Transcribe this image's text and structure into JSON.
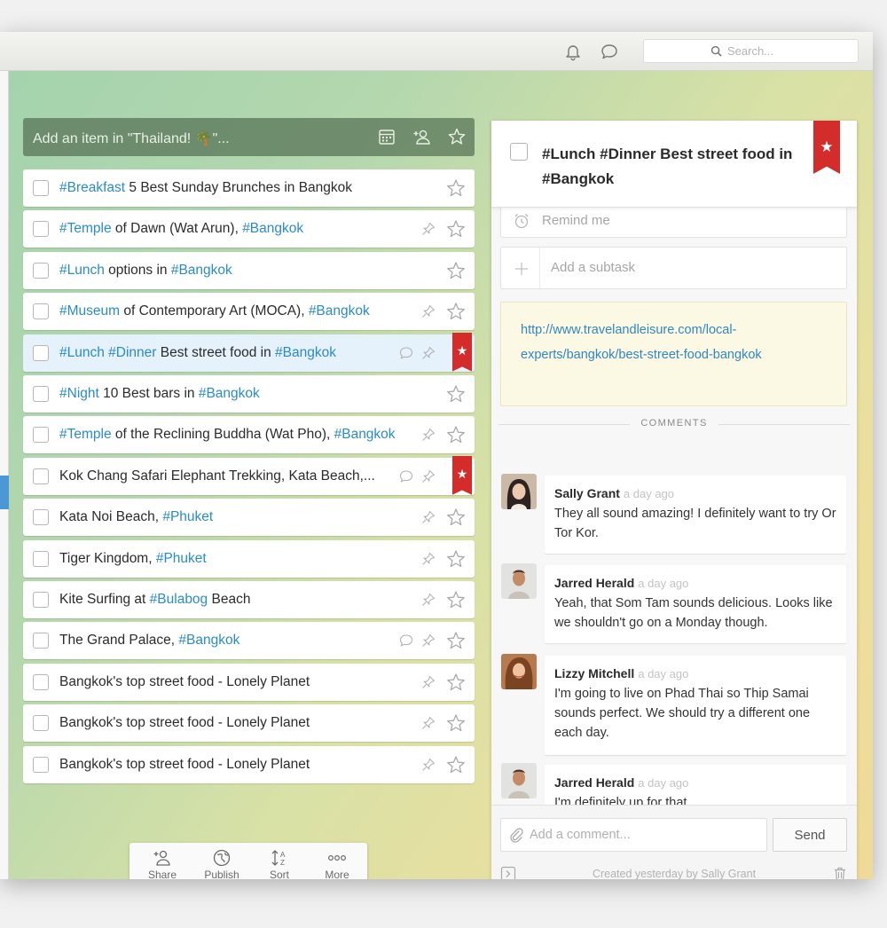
{
  "header": {
    "search_placeholder": "Search..."
  },
  "list": {
    "add_placeholder": "Add an item in \"Thailand! 🌴\"...",
    "tasks": [
      {
        "parts": [
          {
            "t": "#Breakfast",
            "tag": true
          },
          {
            "t": " 5 Best Sunday Brunches in Bangkok"
          }
        ],
        "pin": false,
        "comment": false,
        "starred": false,
        "selected": false
      },
      {
        "parts": [
          {
            "t": "#Temple",
            "tag": true
          },
          {
            "t": " of Dawn (Wat Arun), "
          },
          {
            "t": "#Bangkok",
            "tag": true
          }
        ],
        "pin": true,
        "comment": false,
        "starred": false,
        "selected": false
      },
      {
        "parts": [
          {
            "t": "#Lunch",
            "tag": true
          },
          {
            "t": " options in "
          },
          {
            "t": "#Bangkok",
            "tag": true
          }
        ],
        "pin": false,
        "comment": false,
        "starred": false,
        "selected": false
      },
      {
        "parts": [
          {
            "t": "#Museum",
            "tag": true
          },
          {
            "t": " of Contemporary Art (MOCA), "
          },
          {
            "t": "#Bangkok",
            "tag": true
          }
        ],
        "pin": true,
        "comment": false,
        "starred": false,
        "selected": false
      },
      {
        "parts": [
          {
            "t": "#Lunch",
            "tag": true
          },
          {
            "t": " "
          },
          {
            "t": "#Dinner",
            "tag": true
          },
          {
            "t": " Best street food in "
          },
          {
            "t": "#Bangkok",
            "tag": true
          }
        ],
        "pin": true,
        "comment": true,
        "starred": true,
        "selected": true
      },
      {
        "parts": [
          {
            "t": "#Night",
            "tag": true
          },
          {
            "t": " 10 Best bars in "
          },
          {
            "t": "#Bangkok",
            "tag": true
          }
        ],
        "pin": false,
        "comment": false,
        "starred": false,
        "selected": false
      },
      {
        "parts": [
          {
            "t": "#Temple",
            "tag": true
          },
          {
            "t": " of the Reclining Buddha (Wat Pho), "
          },
          {
            "t": "#Bangkok",
            "tag": true
          }
        ],
        "pin": true,
        "comment": false,
        "starred": false,
        "selected": false
      },
      {
        "parts": [
          {
            "t": "Kok Chang Safari Elephant Trekking, Kata Beach,..."
          }
        ],
        "pin": true,
        "comment": true,
        "starred": true,
        "selected": false
      },
      {
        "parts": [
          {
            "t": "Kata Noi Beach, "
          },
          {
            "t": "#Phuket",
            "tag": true
          }
        ],
        "pin": true,
        "comment": false,
        "starred": false,
        "selected": false
      },
      {
        "parts": [
          {
            "t": "Tiger Kingdom, "
          },
          {
            "t": "#Phuket",
            "tag": true
          }
        ],
        "pin": true,
        "comment": false,
        "starred": false,
        "selected": false
      },
      {
        "parts": [
          {
            "t": "Kite Surfing at "
          },
          {
            "t": "#Bulabog",
            "tag": true
          },
          {
            "t": " Beach"
          }
        ],
        "pin": true,
        "comment": false,
        "starred": false,
        "selected": false
      },
      {
        "parts": [
          {
            "t": "The Grand Palace, "
          },
          {
            "t": "#Bangkok",
            "tag": true
          }
        ],
        "pin": true,
        "comment": true,
        "starred": false,
        "selected": false
      },
      {
        "parts": [
          {
            "t": "Bangkok's top street food - Lonely Planet"
          }
        ],
        "pin": true,
        "comment": false,
        "starred": false,
        "selected": false
      },
      {
        "parts": [
          {
            "t": "Bangkok's top street food - Lonely Planet"
          }
        ],
        "pin": true,
        "comment": false,
        "starred": false,
        "selected": false
      },
      {
        "parts": [
          {
            "t": "Bangkok's top street food - Lonely Planet"
          }
        ],
        "pin": true,
        "comment": false,
        "starred": false,
        "selected": false
      }
    ]
  },
  "toolbar": {
    "share": "Share",
    "publish": "Publish",
    "sort": "Sort",
    "more": "More"
  },
  "detail": {
    "title": "#Lunch #Dinner Best street food in #Bangkok",
    "remind_label": "Remind me",
    "subtask_placeholder": "Add a subtask",
    "note": "http://www.travelandleisure.com/local-experts/bangkok/best-street-food-bangkok",
    "comments_header": "COMMENTS",
    "comments": [
      {
        "author": "Sally Grant",
        "time": "a day ago",
        "text": "They all sound amazing! I definitely want to try Or Tor Kor."
      },
      {
        "author": "Jarred Herald",
        "time": "a day ago",
        "text": "Yeah, that Som Tam sounds delicious. Looks like we shouldn't go on a Monday though."
      },
      {
        "author": "Lizzy Mitchell",
        "time": "a day ago",
        "text": "I'm going to live on Phad Thai so Thip Samai sounds perfect. We should try a different one each day."
      },
      {
        "author": "Jarred Herald",
        "time": "a day ago",
        "text": "I'm definitely up for that."
      }
    ],
    "comment_placeholder": "Add a comment...",
    "send_label": "Send",
    "created_text": "Created yesterday by Sally Grant"
  },
  "colors": {
    "accent_blue": "#2b8bc9",
    "star_red": "#d42b2b",
    "selected_row": "#e5f1fb"
  },
  "icons": [
    "bell-icon",
    "chat-icon",
    "search-icon",
    "calendar-icon",
    "assign-user-icon",
    "star-icon",
    "pin-icon",
    "comment-icon",
    "alarm-clock-icon",
    "plus-icon",
    "paperclip-icon",
    "expand-icon",
    "trash-icon"
  ]
}
